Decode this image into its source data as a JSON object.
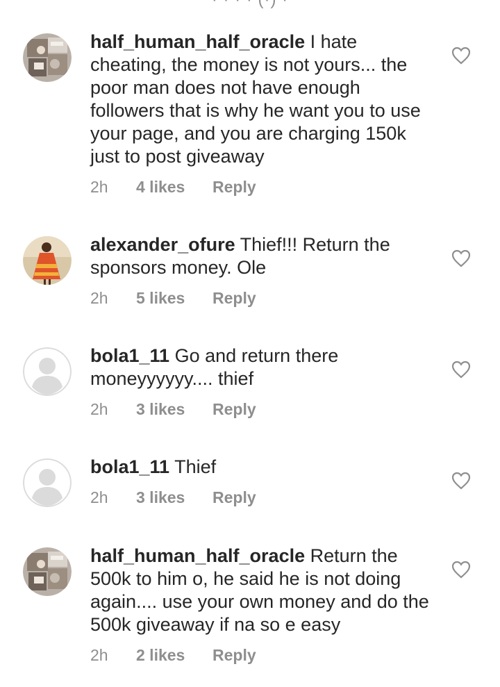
{
  "top_cut_text": "· · · · (·) ·",
  "comments": [
    {
      "username": "half_human_half_oracle",
      "text": "I hate cheating, the money is not yours... the poor man does not have enough followers that is why he want you to use your page, and you are charging 150k just to post giveaway",
      "time": "2h",
      "likes": "4 likes",
      "reply": "Reply",
      "avatar": "photo-collage-icon"
    },
    {
      "username": "alexander_ofure",
      "text": "Thief!!! Return the sponsors money. Ole",
      "time": "2h",
      "likes": "5 likes",
      "reply": "Reply",
      "avatar": "person-photo-icon"
    },
    {
      "username": "bola1_11",
      "text": "Go and return there moneyyyyyy.... thief",
      "time": "2h",
      "likes": "3 likes",
      "reply": "Reply",
      "avatar": "default-profile-icon"
    },
    {
      "username": "bola1_11",
      "text": "Thief",
      "time": "2h",
      "likes": "3 likes",
      "reply": "Reply",
      "avatar": "default-profile-icon"
    },
    {
      "username": "half_human_half_oracle",
      "text": "Return the 500k to him o, he said he is not doing again.... use your own money and do the 500k giveaway if na so e easy",
      "time": "2h",
      "likes": "2 likes",
      "reply": "Reply",
      "avatar": "photo-collage-icon"
    }
  ],
  "colors": {
    "text": "#262626",
    "meta": "#8e8e8e",
    "default_avatar_bg": "#dbdbdb"
  }
}
